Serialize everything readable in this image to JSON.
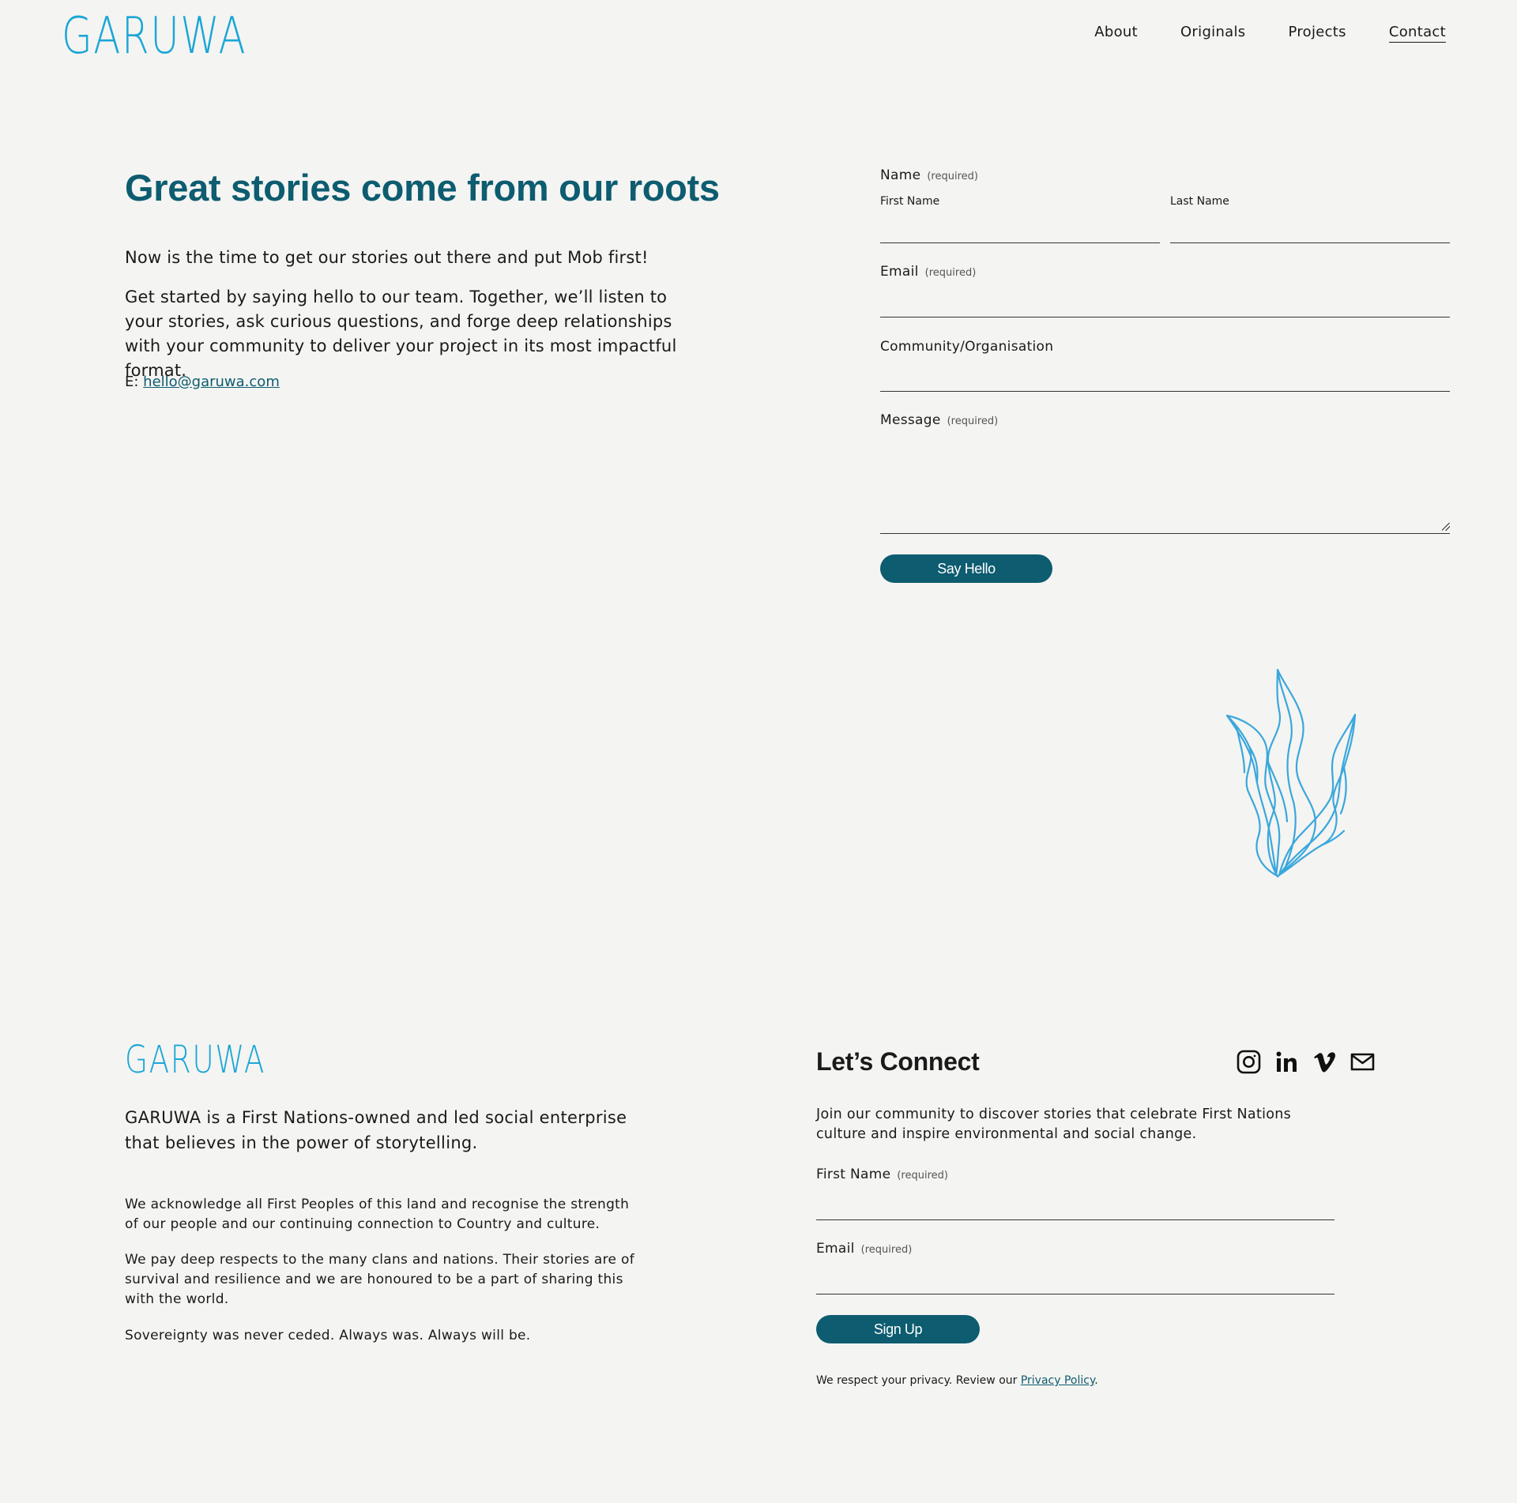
{
  "header": {
    "logo": "GARUWA",
    "nav": [
      "About",
      "Originals",
      "Projects",
      "Contact"
    ]
  },
  "hero": {
    "title": "Great stories come from our roots",
    "paragraph1": "Now is the time to get our stories out there and put Mob first!",
    "paragraph2": "Get started by saying hello to our team. Together, we’ll listen to your stories, ask curious questions, and forge deep relationships with your community to deliver your project in its most impactful format.",
    "email_prefix": "E:",
    "email": "hello@garuwa.com"
  },
  "contact_form": {
    "name_label": "Name",
    "required": "(required)",
    "first_name": "First Name",
    "last_name": "Last Name",
    "email_label": "Email",
    "community_label": "Community/Organisation",
    "message_label": "Message",
    "submit": "Say Hello"
  },
  "footer": {
    "logo": "GARUWA",
    "tagline": "GARUWA is a First Nations-owned and led social enterprise that believes in the power of storytelling.",
    "ack1": "We acknowledge all First Peoples of this land and recognise the strength of our people and our continuing connection to Country and culture.",
    "ack2": "We pay deep respects to the many clans and nations. Their stories are of survival and resilience and we are honoured to be a part of sharing this with the world.",
    "ack3": "Sovereignty was never ceded. Always was. Always will be.",
    "connect_title": "Let’s Connect",
    "connect_desc": "Join our community to discover stories that celebrate First Nations culture and inspire environmental and social change.",
    "first_name_label": "First Name",
    "email_label": "Email",
    "required": "(required)",
    "signup": "Sign Up",
    "privacy_text": "We respect your privacy. Review our",
    "privacy_link": "Privacy Policy",
    "privacy_end": ".",
    "social_icons": [
      "instagram-icon",
      "linkedin-icon",
      "vimeo-icon",
      "mail-icon"
    ]
  },
  "colors": {
    "background": "#f4f4f2",
    "accent_teal": "#0d5c70",
    "logo_blue": "#1aa6d6",
    "illustration_blue": "#3aa7dc"
  }
}
